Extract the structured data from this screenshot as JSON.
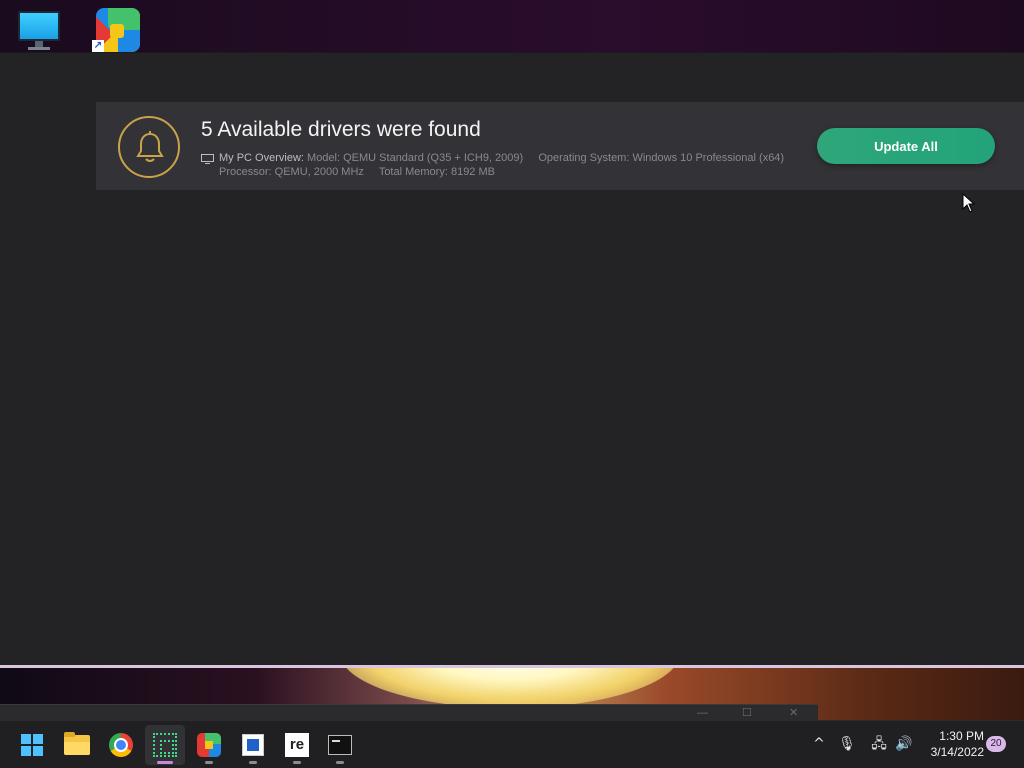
{
  "notice": {
    "title": "5 Available drivers were found",
    "overview_label": "My PC Overview:",
    "model_label": "Model:",
    "model_value": "QEMU Standard (Q35 + ICH9, 2009)",
    "os_label": "Operating System:",
    "os_value": "Windows 10 Professional (x64)",
    "processor_label": "Processor:",
    "processor_value": "QEMU, 2000 MHz",
    "memory_label": "Total Memory:",
    "memory_value": "8192 MB",
    "update_button": "Update All"
  },
  "background_window": {
    "minimize": "—",
    "maximize": "☐",
    "close": "✕"
  },
  "taskbar": {
    "apps": [
      {
        "name": "start",
        "icon": "windows-logo-icon"
      },
      {
        "name": "file-explorer",
        "icon": "folder-icon"
      },
      {
        "name": "chrome",
        "icon": "chrome-icon"
      },
      {
        "name": "grid-app",
        "icon": "dotted-grid-icon"
      },
      {
        "name": "driver-app",
        "icon": "colorful-tile-icon"
      },
      {
        "name": "document-app",
        "icon": "document-icon"
      },
      {
        "name": "re-app",
        "icon": "re-icon",
        "label": "re"
      },
      {
        "name": "terminal",
        "icon": "terminal-icon"
      }
    ],
    "tray": {
      "chevron": "^",
      "mic": "🎙",
      "network": "🖧",
      "volume": "🔊"
    },
    "time": "1:30 PM",
    "date": "3/14/2022",
    "notification_count": "20"
  },
  "colors": {
    "accent_green": "#23a37a",
    "bell_gold": "#c9a24a",
    "panel_bg": "#333236",
    "window_bg": "#232225"
  }
}
